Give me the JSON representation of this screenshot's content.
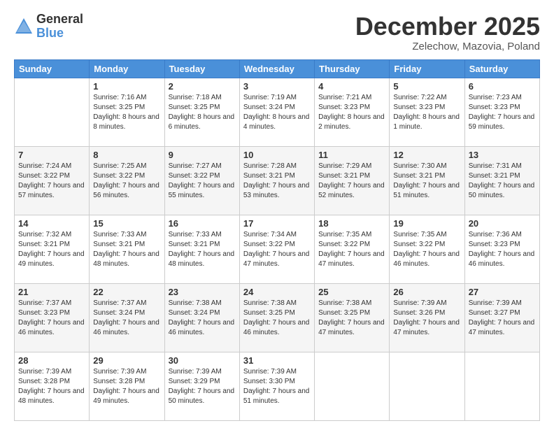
{
  "logo": {
    "general": "General",
    "blue": "Blue"
  },
  "header": {
    "month": "December 2025",
    "location": "Zelechow, Mazovia, Poland"
  },
  "weekdays": [
    "Sunday",
    "Monday",
    "Tuesday",
    "Wednesday",
    "Thursday",
    "Friday",
    "Saturday"
  ],
  "weeks": [
    [
      {
        "day": "",
        "sunrise": "",
        "sunset": "",
        "daylight": ""
      },
      {
        "day": "1",
        "sunrise": "Sunrise: 7:16 AM",
        "sunset": "Sunset: 3:25 PM",
        "daylight": "Daylight: 8 hours and 8 minutes."
      },
      {
        "day": "2",
        "sunrise": "Sunrise: 7:18 AM",
        "sunset": "Sunset: 3:25 PM",
        "daylight": "Daylight: 8 hours and 6 minutes."
      },
      {
        "day": "3",
        "sunrise": "Sunrise: 7:19 AM",
        "sunset": "Sunset: 3:24 PM",
        "daylight": "Daylight: 8 hours and 4 minutes."
      },
      {
        "day": "4",
        "sunrise": "Sunrise: 7:21 AM",
        "sunset": "Sunset: 3:23 PM",
        "daylight": "Daylight: 8 hours and 2 minutes."
      },
      {
        "day": "5",
        "sunrise": "Sunrise: 7:22 AM",
        "sunset": "Sunset: 3:23 PM",
        "daylight": "Daylight: 8 hours and 1 minute."
      },
      {
        "day": "6",
        "sunrise": "Sunrise: 7:23 AM",
        "sunset": "Sunset: 3:23 PM",
        "daylight": "Daylight: 7 hours and 59 minutes."
      }
    ],
    [
      {
        "day": "7",
        "sunrise": "Sunrise: 7:24 AM",
        "sunset": "Sunset: 3:22 PM",
        "daylight": "Daylight: 7 hours and 57 minutes."
      },
      {
        "day": "8",
        "sunrise": "Sunrise: 7:25 AM",
        "sunset": "Sunset: 3:22 PM",
        "daylight": "Daylight: 7 hours and 56 minutes."
      },
      {
        "day": "9",
        "sunrise": "Sunrise: 7:27 AM",
        "sunset": "Sunset: 3:22 PM",
        "daylight": "Daylight: 7 hours and 55 minutes."
      },
      {
        "day": "10",
        "sunrise": "Sunrise: 7:28 AM",
        "sunset": "Sunset: 3:21 PM",
        "daylight": "Daylight: 7 hours and 53 minutes."
      },
      {
        "day": "11",
        "sunrise": "Sunrise: 7:29 AM",
        "sunset": "Sunset: 3:21 PM",
        "daylight": "Daylight: 7 hours and 52 minutes."
      },
      {
        "day": "12",
        "sunrise": "Sunrise: 7:30 AM",
        "sunset": "Sunset: 3:21 PM",
        "daylight": "Daylight: 7 hours and 51 minutes."
      },
      {
        "day": "13",
        "sunrise": "Sunrise: 7:31 AM",
        "sunset": "Sunset: 3:21 PM",
        "daylight": "Daylight: 7 hours and 50 minutes."
      }
    ],
    [
      {
        "day": "14",
        "sunrise": "Sunrise: 7:32 AM",
        "sunset": "Sunset: 3:21 PM",
        "daylight": "Daylight: 7 hours and 49 minutes."
      },
      {
        "day": "15",
        "sunrise": "Sunrise: 7:33 AM",
        "sunset": "Sunset: 3:21 PM",
        "daylight": "Daylight: 7 hours and 48 minutes."
      },
      {
        "day": "16",
        "sunrise": "Sunrise: 7:33 AM",
        "sunset": "Sunset: 3:21 PM",
        "daylight": "Daylight: 7 hours and 48 minutes."
      },
      {
        "day": "17",
        "sunrise": "Sunrise: 7:34 AM",
        "sunset": "Sunset: 3:22 PM",
        "daylight": "Daylight: 7 hours and 47 minutes."
      },
      {
        "day": "18",
        "sunrise": "Sunrise: 7:35 AM",
        "sunset": "Sunset: 3:22 PM",
        "daylight": "Daylight: 7 hours and 47 minutes."
      },
      {
        "day": "19",
        "sunrise": "Sunrise: 7:35 AM",
        "sunset": "Sunset: 3:22 PM",
        "daylight": "Daylight: 7 hours and 46 minutes."
      },
      {
        "day": "20",
        "sunrise": "Sunrise: 7:36 AM",
        "sunset": "Sunset: 3:23 PM",
        "daylight": "Daylight: 7 hours and 46 minutes."
      }
    ],
    [
      {
        "day": "21",
        "sunrise": "Sunrise: 7:37 AM",
        "sunset": "Sunset: 3:23 PM",
        "daylight": "Daylight: 7 hours and 46 minutes."
      },
      {
        "day": "22",
        "sunrise": "Sunrise: 7:37 AM",
        "sunset": "Sunset: 3:24 PM",
        "daylight": "Daylight: 7 hours and 46 minutes."
      },
      {
        "day": "23",
        "sunrise": "Sunrise: 7:38 AM",
        "sunset": "Sunset: 3:24 PM",
        "daylight": "Daylight: 7 hours and 46 minutes."
      },
      {
        "day": "24",
        "sunrise": "Sunrise: 7:38 AM",
        "sunset": "Sunset: 3:25 PM",
        "daylight": "Daylight: 7 hours and 46 minutes."
      },
      {
        "day": "25",
        "sunrise": "Sunrise: 7:38 AM",
        "sunset": "Sunset: 3:25 PM",
        "daylight": "Daylight: 7 hours and 47 minutes."
      },
      {
        "day": "26",
        "sunrise": "Sunrise: 7:39 AM",
        "sunset": "Sunset: 3:26 PM",
        "daylight": "Daylight: 7 hours and 47 minutes."
      },
      {
        "day": "27",
        "sunrise": "Sunrise: 7:39 AM",
        "sunset": "Sunset: 3:27 PM",
        "daylight": "Daylight: 7 hours and 47 minutes."
      }
    ],
    [
      {
        "day": "28",
        "sunrise": "Sunrise: 7:39 AM",
        "sunset": "Sunset: 3:28 PM",
        "daylight": "Daylight: 7 hours and 48 minutes."
      },
      {
        "day": "29",
        "sunrise": "Sunrise: 7:39 AM",
        "sunset": "Sunset: 3:28 PM",
        "daylight": "Daylight: 7 hours and 49 minutes."
      },
      {
        "day": "30",
        "sunrise": "Sunrise: 7:39 AM",
        "sunset": "Sunset: 3:29 PM",
        "daylight": "Daylight: 7 hours and 50 minutes."
      },
      {
        "day": "31",
        "sunrise": "Sunrise: 7:39 AM",
        "sunset": "Sunset: 3:30 PM",
        "daylight": "Daylight: 7 hours and 51 minutes."
      },
      {
        "day": "",
        "sunrise": "",
        "sunset": "",
        "daylight": ""
      },
      {
        "day": "",
        "sunrise": "",
        "sunset": "",
        "daylight": ""
      },
      {
        "day": "",
        "sunrise": "",
        "sunset": "",
        "daylight": ""
      }
    ]
  ]
}
